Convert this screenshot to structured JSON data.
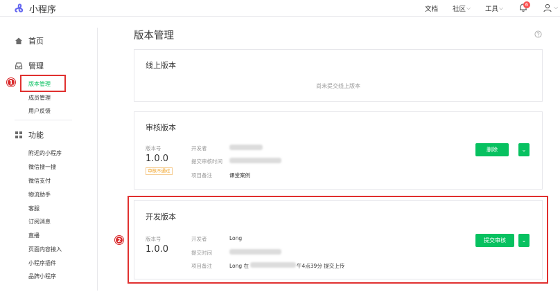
{
  "app": {
    "name": "小程序"
  },
  "topnav": {
    "docs": "文档",
    "community": "社区",
    "tools": "工具",
    "notif_count": "6"
  },
  "sidebar": {
    "home": "首页",
    "manage": "管理",
    "manage_items": [
      "版本管理",
      "成员管理",
      "用户反馈"
    ],
    "features": "功能",
    "feature_items": [
      "附近的小程序",
      "微信搜一搜",
      "微信支付",
      "物流助手",
      "客服",
      "订阅消息",
      "直播",
      "页面内容接入",
      "小程序插件",
      "品牌小程序"
    ]
  },
  "annotations": {
    "marker1": "1",
    "marker2": "2"
  },
  "main": {
    "title": "版本管理",
    "online": {
      "title": "线上版本",
      "empty": "尚未提交线上版本"
    },
    "review": {
      "title": "审核版本",
      "version_label": "版本号",
      "version": "1.0.0",
      "status_tag": "审核不通过",
      "dev_label": "开发者",
      "submit_time_label": "提交审核时间",
      "remark_label": "项目备注",
      "remark": "课堂案例",
      "action": "删除"
    },
    "dev": {
      "title": "开发版本",
      "version_label": "版本号",
      "version": "1.0.0",
      "dev_label": "开发者",
      "dev": "Long",
      "submit_time_label": "提交时间",
      "remark_label": "项目备注",
      "remark_prefix": "Long 在",
      "remark_suffix": "午4点39分 提交上传",
      "action": "提交审核"
    }
  },
  "colors": {
    "accent": "#07c160",
    "annotation": "#e0302f",
    "badge": "#fa5151"
  }
}
